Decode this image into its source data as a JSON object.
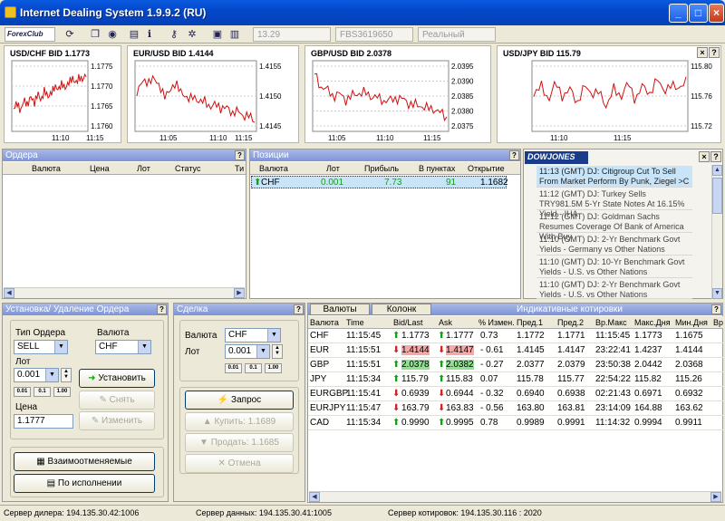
{
  "window": {
    "title": "Internet Dealing System 1.9.9.2 (RU)"
  },
  "toolbar": {
    "logo": "ForexClub",
    "field1": "13.29",
    "field2": "FBS3619650",
    "field3": "Реальный",
    "icons": [
      "refresh-icon",
      "copy-icon",
      "chart-icon",
      "document-icon",
      "info-icon",
      "key-icon",
      "gear-icon",
      "disk-icon",
      "book-icon"
    ]
  },
  "charts": [
    {
      "title": "USD/CHF BID 1.1773",
      "yticks": [
        "1.1775",
        "1.1770",
        "1.1765",
        "1.1760"
      ],
      "xticks": [
        "11:10",
        "11:15"
      ]
    },
    {
      "title": "EUR/USD BID 1.4144",
      "yticks": [
        "1.4155",
        "1.4150",
        "1.4145"
      ],
      "xticks": [
        "11:05",
        "11:10",
        "11:15"
      ]
    },
    {
      "title": "GBP/USD BID 2.0378",
      "yticks": [
        "2.0395",
        "2.0390",
        "2.0385",
        "2.0380",
        "2.0375"
      ],
      "xticks": [
        "11:05",
        "11:10",
        "11:15"
      ]
    },
    {
      "title": "USD/JPY BID 115.79",
      "yticks": [
        "115.80",
        "115.76",
        "115.72"
      ],
      "xticks": [
        "11:10",
        "11:15"
      ]
    }
  ],
  "orders": {
    "title": "Ордера",
    "columns": [
      "Валюта",
      "Цена",
      "Лот",
      "Статус",
      "Ти"
    ]
  },
  "positions": {
    "title": "Позиции",
    "columns": [
      "Валюта",
      "Лот",
      "Прибыль",
      "В пунктах",
      "Открытие"
    ],
    "rows": [
      {
        "currency": "CHF",
        "lot": "0.001",
        "profit": "7.73",
        "points": "91",
        "open": "1.1682"
      }
    ]
  },
  "news": {
    "source": "DOWJONES",
    "items": [
      "11:13 (GMT) DJ: Citigroup Cut To Sell From Market Perform By Punk, Ziegel >C",
      "11:12 (GMT) DJ: Turkey Sells TRY981.5M 5-Yr State Notes At 16.15% Yield - IHA",
      "11:12 (GMT) DJ: Goldman Sachs Resumes Coverage Of Bank of America With Buy",
      "11:10 (GMT) DJ: 2-Yr Benchmark Govt Yields - Germany vs Other Nations",
      "11:10 (GMT) DJ: 10-Yr Benchmark Govt Yields - U.S. vs Other Nations",
      "11:10 (GMT) DJ: 2-Yr Benchmark Govt Yields - U.S. vs Other Nations"
    ]
  },
  "order_form": {
    "title": "Установка/ Удаление  Ордера",
    "type_label": "Тип Ордера",
    "type_value": "SELL",
    "currency_label": "Валюта",
    "currency_value": "CHF",
    "lot_label": "Лот",
    "lot_value": "0.001",
    "price_label": "Цена",
    "price_value": "1.1777",
    "set": "Установить",
    "remove": "Снять",
    "change": "Изменить",
    "interchangeable": "Взаимоотменяемые",
    "on_execution": "По исполнении",
    "lot_steps": [
      "0.01",
      "0.1",
      "1.00"
    ]
  },
  "deal": {
    "title": "Сделка",
    "currency_label": "Валюта",
    "currency_value": "CHF",
    "lot_label": "Лот",
    "lot_value": "0.001",
    "lot_steps": [
      "0.01",
      "0.1",
      "1.00"
    ],
    "request": "Запрос",
    "buy": "Купить: 1.1689",
    "sell": "Продать: 1.1685",
    "cancel": "Отмена"
  },
  "quotes": {
    "tab1": "Валюты",
    "tab2": "Колонк",
    "title": "Индикативные котировки",
    "columns": [
      "Валюта",
      "Time",
      "Bid/Last",
      "Ask",
      "% Измен.",
      "Пред.1",
      "Пред.2",
      "Вр.Макс",
      "Макс.Дня",
      "Мин.Дня",
      "Вр"
    ],
    "rows": [
      {
        "c": "CHF",
        "t": "11:15:45",
        "bid": "1.1773",
        "bd": "up",
        "ask": "1.1777",
        "ad": "up",
        "chg": "0.73",
        "p1": "1.1772",
        "p2": "1.1771",
        "tm": "11:15:45",
        "mx": "1.1773",
        "mn": "1.1675",
        "hl": ""
      },
      {
        "c": "EUR",
        "t": "11:15:51",
        "bid": "1.4144",
        "bd": "dn",
        "ask": "1.4147",
        "ad": "dn",
        "chg": "- 0.61",
        "p1": "1.4145",
        "p2": "1.4147",
        "tm": "23:22:41",
        "mx": "1.4237",
        "mn": "1.4144",
        "hl": "r"
      },
      {
        "c": "GBP",
        "t": "11:15:51",
        "bid": "2.0378",
        "bd": "up",
        "ask": "2.0382",
        "ad": "up",
        "chg": "- 0.27",
        "p1": "2.0377",
        "p2": "2.0379",
        "tm": "23:50:38",
        "mx": "2.0442",
        "mn": "2.0368",
        "hl": "g"
      },
      {
        "c": "JPY",
        "t": "11:15:34",
        "bid": "115.79",
        "bd": "up",
        "ask": "115.83",
        "ad": "up",
        "chg": "0.07",
        "p1": "115.78",
        "p2": "115.77",
        "tm": "22:54:22",
        "mx": "115.82",
        "mn": "115.26",
        "hl": ""
      },
      {
        "c": "EURGBP",
        "t": "11:15:41",
        "bid": "0.6939",
        "bd": "dn",
        "ask": "0.6944",
        "ad": "dn",
        "chg": "- 0.32",
        "p1": "0.6940",
        "p2": "0.6938",
        "tm": "02:21:43",
        "mx": "0.6971",
        "mn": "0.6932",
        "hl": ""
      },
      {
        "c": "EURJPY",
        "t": "11:15:47",
        "bid": "163.79",
        "bd": "dn",
        "ask": "163.83",
        "ad": "dn",
        "chg": "- 0.56",
        "p1": "163.80",
        "p2": "163.81",
        "tm": "23:14:09",
        "mx": "164.88",
        "mn": "163.62",
        "hl": ""
      },
      {
        "c": "CAD",
        "t": "11:15:34",
        "bid": "0.9990",
        "bd": "up",
        "ask": "0.9995",
        "ad": "up",
        "chg": "0.78",
        "p1": "0.9989",
        "p2": "0.9991",
        "tm": "11:14:32",
        "mx": "0.9994",
        "mn": "0.9911",
        "hl": ""
      }
    ]
  },
  "status": {
    "dealer": "Сервер дилера: 194.135.30.42:1006",
    "data": "Сервер данных: 194.135.30.41:1005",
    "quotes": "Сервер котировок: 194.135.30.116 : 2020"
  }
}
